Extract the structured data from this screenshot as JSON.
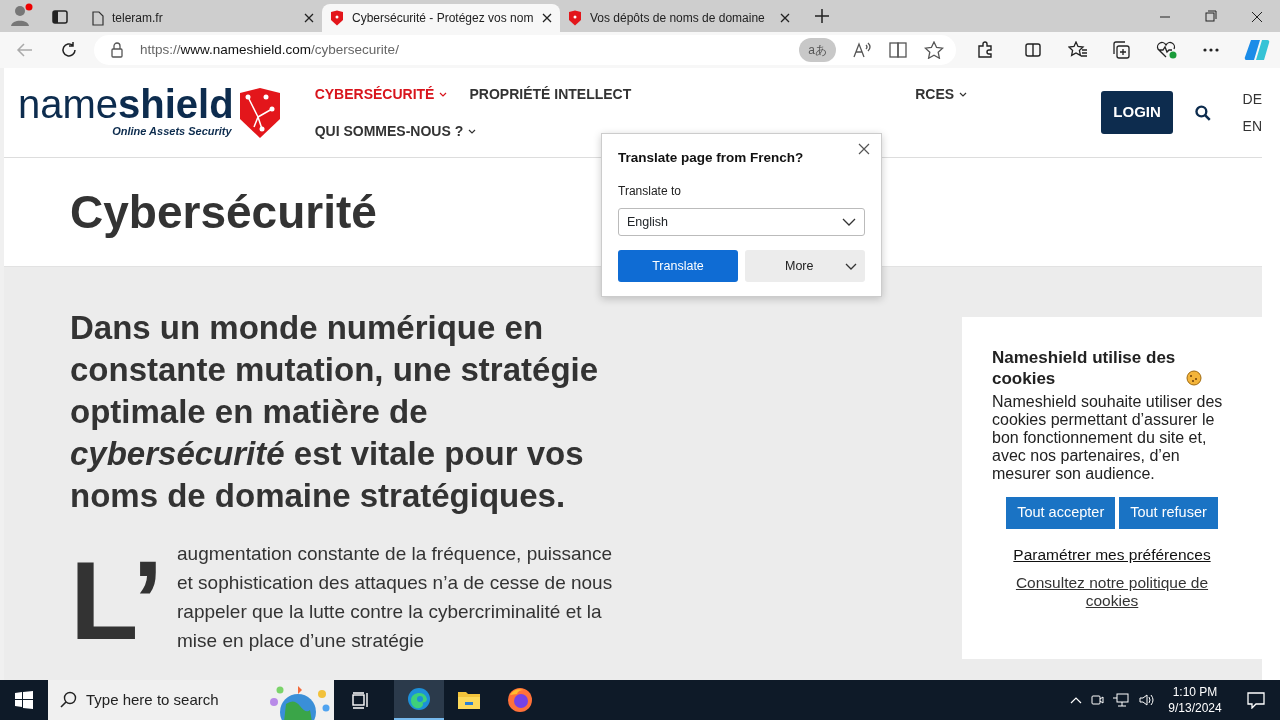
{
  "browser": {
    "tabs": [
      {
        "title": "teleram.fr",
        "kind": "page",
        "selected": false
      },
      {
        "title": "Cybersécurité - Protégez vos nom",
        "kind": "shield",
        "selected": true
      },
      {
        "title": "Vos dépôts de noms de domaine",
        "kind": "shield",
        "selected": false
      }
    ],
    "address": {
      "scheme": "https://",
      "host": "www.nameshield.com",
      "path": "/cybersecurite/"
    },
    "translate_chip": "aあ"
  },
  "site": {
    "logo": {
      "name_light": "name",
      "name_bold": "shield",
      "tagline": "Online Assets Security"
    },
    "nav": [
      {
        "label": "CYBERSÉCURITÉ",
        "active": true,
        "caret": true
      },
      {
        "label": "PROPRIÉTÉ INTELLECT",
        "active": false,
        "caret": false
      },
      {
        "label": "RCES",
        "active": false,
        "caret": true
      },
      {
        "label": "QUI SOMMES-NOUS ?",
        "active": false,
        "caret": true
      }
    ],
    "login": "LOGIN",
    "languages": [
      "DE",
      "EN"
    ],
    "page_title": "Cybersécurité",
    "headline": "Dans un monde numérique en constante mutation, une stratégie optimale en matière de *cybersécurité* est vitale pour vos noms de domaine stratégiques.",
    "drop_cap": "L’",
    "paragraph": "augmentation constante de la fréquence, puissance et sophistication des attaques n’a de cesse de nous rappeler que la lutte contre la cybercriminalité et la mise en place d’une stratégie"
  },
  "translate_popup": {
    "title": "Translate page from French?",
    "label": "Translate to",
    "language": "English",
    "primary": "Translate",
    "secondary": "More"
  },
  "cookie_banner": {
    "title": "Nameshield utilise des cookies",
    "text": "Nameshield souhaite utiliser des cookies permettant d’assurer le bon fonctionnement du site et, avec nos partenaires, d’en mesurer son audience.",
    "accept": "Tout accepter",
    "refuse": "Tout refuser",
    "preferences": "Paramétrer mes préférences",
    "policy": "Consultez notre politique de cookies"
  },
  "taskbar": {
    "search_placeholder": "Type here to search",
    "time": "1:10 PM",
    "date": "9/13/2024"
  }
}
